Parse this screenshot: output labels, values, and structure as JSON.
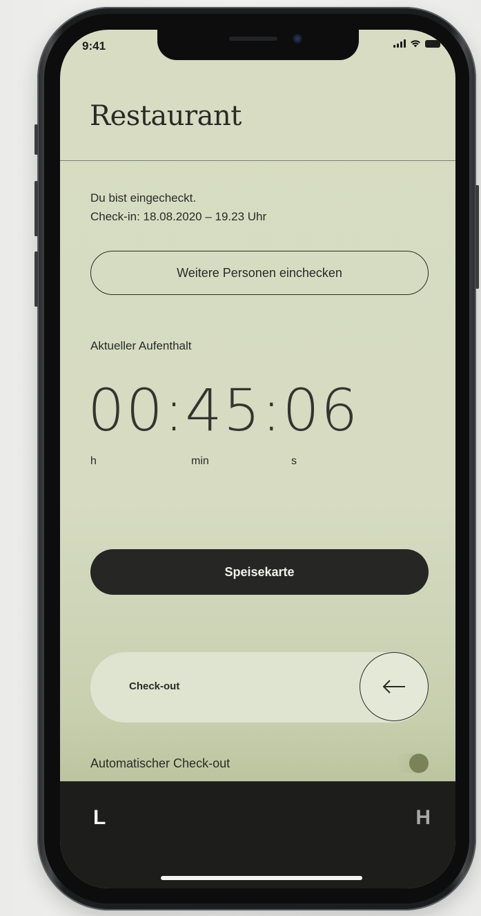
{
  "status_bar": {
    "time": "9:41"
  },
  "header": {
    "title": "Restaurant"
  },
  "checkin": {
    "status_line": "Du bist eingecheckt.",
    "time_line": "Check-in: 18.08.2020 – 19.23 Uhr"
  },
  "buttons": {
    "add_people": "Weitere Personen einchecken",
    "menu": "Speisekarte",
    "checkout": "Check-out"
  },
  "stay": {
    "label": "Aktueller Aufenthalt",
    "timer": "00:45:06",
    "unit_h": "h",
    "unit_min": "min",
    "unit_s": "s"
  },
  "auto_checkout": {
    "label": "Automatischer Check-out",
    "enabled": true
  },
  "bottom_bar": {
    "left_logo": "L",
    "right_logo": "H"
  },
  "icons": {
    "checkout_knob": "arrow-left-icon"
  },
  "colors": {
    "background": "#d7dcc3",
    "primary_dark": "#262624",
    "accent_toggle": "#7c8257"
  }
}
